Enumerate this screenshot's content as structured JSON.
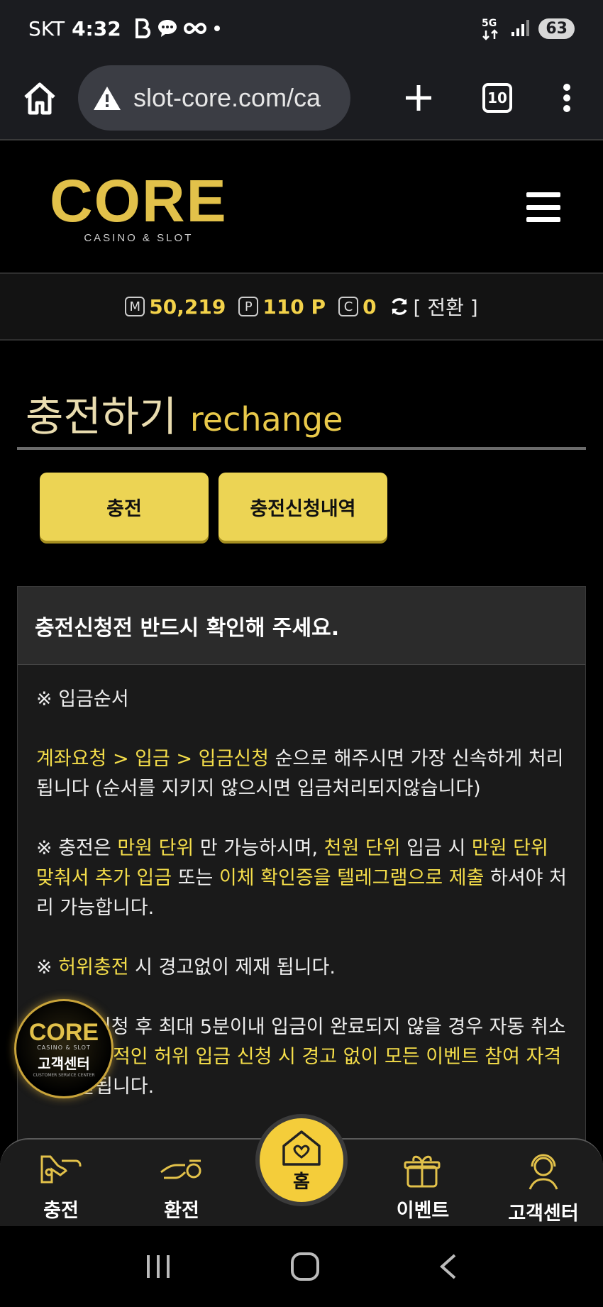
{
  "status_bar": {
    "carrier": "SKT",
    "time": "4:32",
    "network": "5G",
    "battery": "63"
  },
  "browser": {
    "url": "slot-core.com/ca",
    "tab_count": "10"
  },
  "site": {
    "logo_main": "CORE",
    "logo_sub": "CASINO & SLOT"
  },
  "points": {
    "m_badge": "M",
    "m_value": "50,219",
    "p_badge": "P",
    "p_value": "110 P",
    "c_badge": "C",
    "c_value": "0",
    "convert_label": "[ 전환 ]"
  },
  "page": {
    "title_ko": "충전하기",
    "title_en": "rechange"
  },
  "buttons": {
    "charge": "충전",
    "history": "충전신청내역"
  },
  "notice": {
    "heading": "충전신청전 반드시 확인해 주세요.",
    "p1": "※ 입금순서",
    "p2_hl": "계좌요청 > 입금 > 입금신청",
    "p2_rest": " 순으로 해주시면 가장 신속하게 처리됩니다 (순서를 지키지 않으시면 입금처리되지않습니다)",
    "p3_a": "※ 충전은 ",
    "p3_b": "만원 단위",
    "p3_c": " 만 가능하시며, ",
    "p3_d": "천원 단위",
    "p3_e": " 입금 시 ",
    "p3_f": "만원 단위 맞춰서 추가 입금",
    "p3_g": " 또는 ",
    "p3_h": "이체 확인증을 텔레그램으로 제출",
    "p3_i": " 하셔야 처리 가능합니다.",
    "p4_a": "※ ",
    "p4_b": "허위충전",
    "p4_c": " 시 경고없이 제재 됩니다.",
    "p5_a": "※ 입금신청 후 최대 5분이내 입금이 완료되지 않을 경우 자동 취소 ",
    "p5_b": "되며 반복적인 허위 입금 신청 시 경고 없이 모든 이벤트 참여 자격",
    "p5_c": "이 박탈됩니다."
  },
  "cs_badge": {
    "logo": "CORE",
    "sub": "CASINO & SLOT",
    "label": "고객센터",
    "tiny": "CUSTOMER SERVICE CENTER"
  },
  "tab_nav": {
    "charge": "충전",
    "exchange": "환전",
    "home": "홈",
    "event": "이벤트",
    "cs": "고객센터"
  },
  "colors": {
    "accent_yellow": "#f3d24a",
    "button_yellow": "#ecd454",
    "home_yellow": "#f4cd3a",
    "background": "#000000"
  }
}
